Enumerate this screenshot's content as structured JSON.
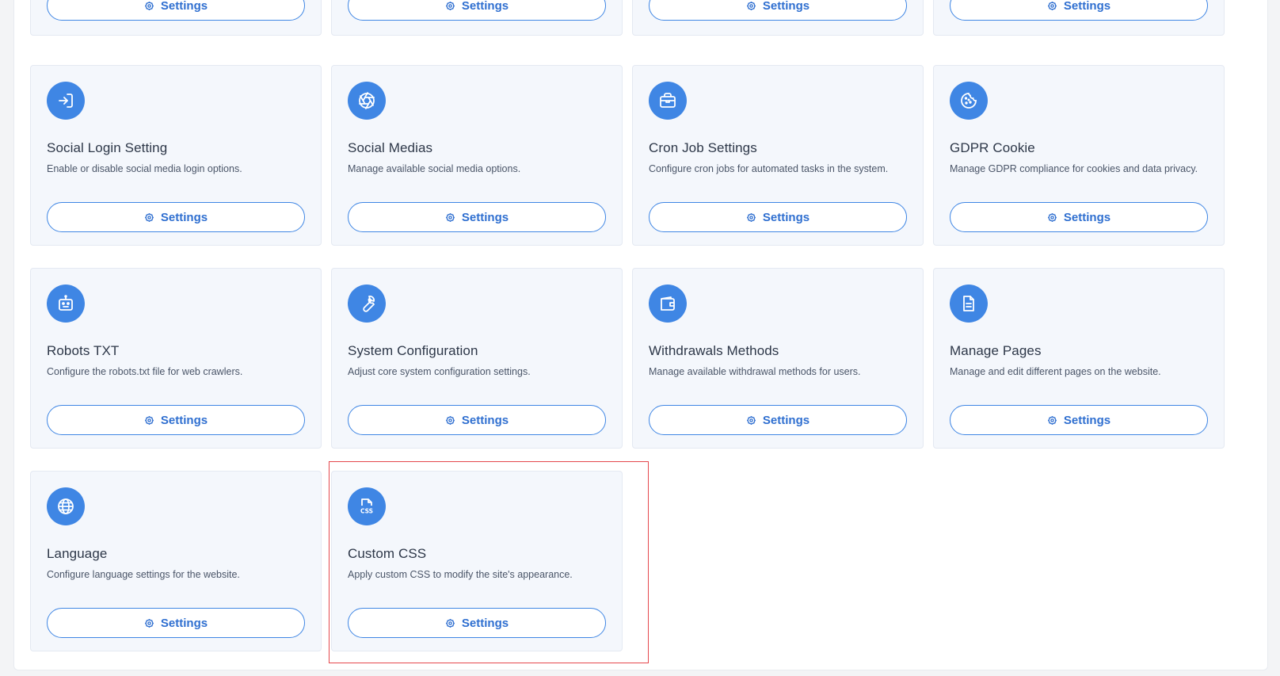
{
  "button_label": "Settings",
  "colors": {
    "accent": "#3f86e4",
    "highlight": "#e5484d"
  },
  "top_row": [
    {
      "button": "Settings"
    },
    {
      "button": "Settings"
    },
    {
      "button": "Settings"
    },
    {
      "button": "Settings"
    }
  ],
  "cards": [
    {
      "title": "Social Login Setting",
      "description": "Enable or disable social media login options.",
      "icon": "login-icon",
      "button": "Settings"
    },
    {
      "title": "Social Medias",
      "description": "Manage available social media options.",
      "icon": "aperture-icon",
      "button": "Settings"
    },
    {
      "title": "Cron Job Settings",
      "description": "Configure cron jobs for automated tasks in the system.",
      "icon": "briefcase-icon",
      "button": "Settings"
    },
    {
      "title": "GDPR Cookie",
      "description": "Manage GDPR compliance for cookies and data privacy.",
      "icon": "cookie-icon",
      "button": "Settings"
    },
    {
      "title": "Robots TXT",
      "description": "Configure the robots.txt file for web crawlers.",
      "icon": "robot-icon",
      "button": "Settings"
    },
    {
      "title": "System Configuration",
      "description": "Adjust core system configuration settings.",
      "icon": "wrench-icon",
      "button": "Settings"
    },
    {
      "title": "Withdrawals Methods",
      "description": "Manage available withdrawal methods for users.",
      "icon": "wallet-icon",
      "button": "Settings"
    },
    {
      "title": "Manage Pages",
      "description": "Manage and edit different pages on the website.",
      "icon": "document-icon",
      "button": "Settings"
    },
    {
      "title": "Language",
      "description": "Configure language settings for the website.",
      "icon": "globe-icon",
      "button": "Settings"
    },
    {
      "title": "Custom CSS",
      "description": "Apply custom CSS to modify the site's appearance.",
      "icon": "css-file-icon",
      "button": "Settings"
    }
  ]
}
